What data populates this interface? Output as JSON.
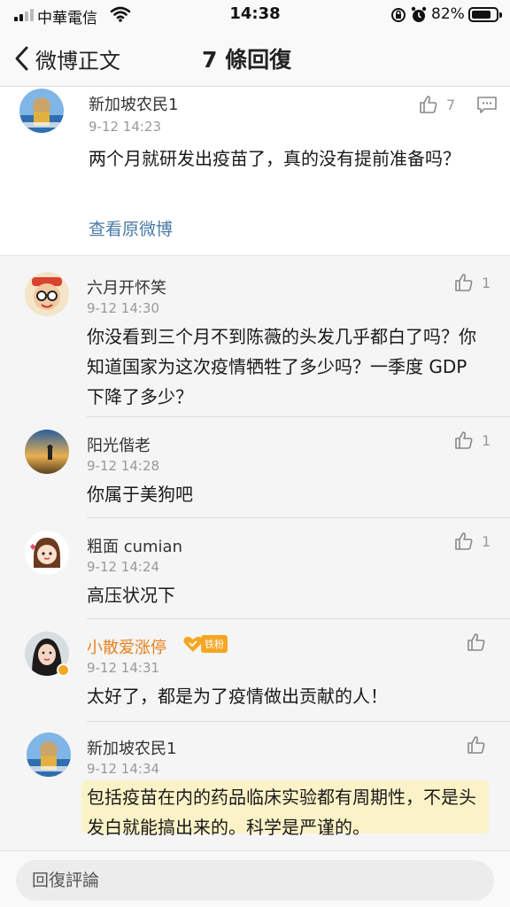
{
  "status_bar": {
    "carrier": "中華電信",
    "time": "14:38",
    "battery_percent": "82%",
    "battery_level": 0.82
  },
  "nav": {
    "back_label": "微博正文",
    "title": "7 條回復"
  },
  "original": {
    "author": "新加坡农民1",
    "time": "9-12 14:23",
    "likes": "7",
    "text": "两个月就研发出疫苗了，真的没有提前准备吗？",
    "view_original": "查看原微博"
  },
  "replies": [
    {
      "author": "六月开怀笑",
      "time": "9-12 14:30",
      "likes": "1",
      "text": "你没看到三个月不到陈薇的头发几乎都白了吗？你知道国家为这次疫情牺牲了多少吗？一季度 GDP 下降了多少？"
    },
    {
      "author": "阳光偕老",
      "time": "9-12 14:28",
      "likes": "1",
      "text": "你属于美狗吧"
    },
    {
      "author": "粗面 cumian",
      "time": "9-12 14:24",
      "likes": "1",
      "text": "高压状况下"
    },
    {
      "author": "小散爱涨停",
      "badge": "铁粉",
      "time": "9-12 14:31",
      "likes": "",
      "text": "太好了，都是为了疫情做出贡献的人！"
    },
    {
      "author": "新加坡农民1",
      "time": "9-12 14:34",
      "likes": "",
      "text": "包括疫苗在内的药品临床实验都有周期性，不是头发白就能搞出来的。科学是严谨的。"
    }
  ],
  "bottom": {
    "placeholder": "回復評論"
  },
  "colors": {
    "link": "#4a7aa6",
    "vip_name": "#e8801c",
    "highlight": "#fff0a0"
  }
}
